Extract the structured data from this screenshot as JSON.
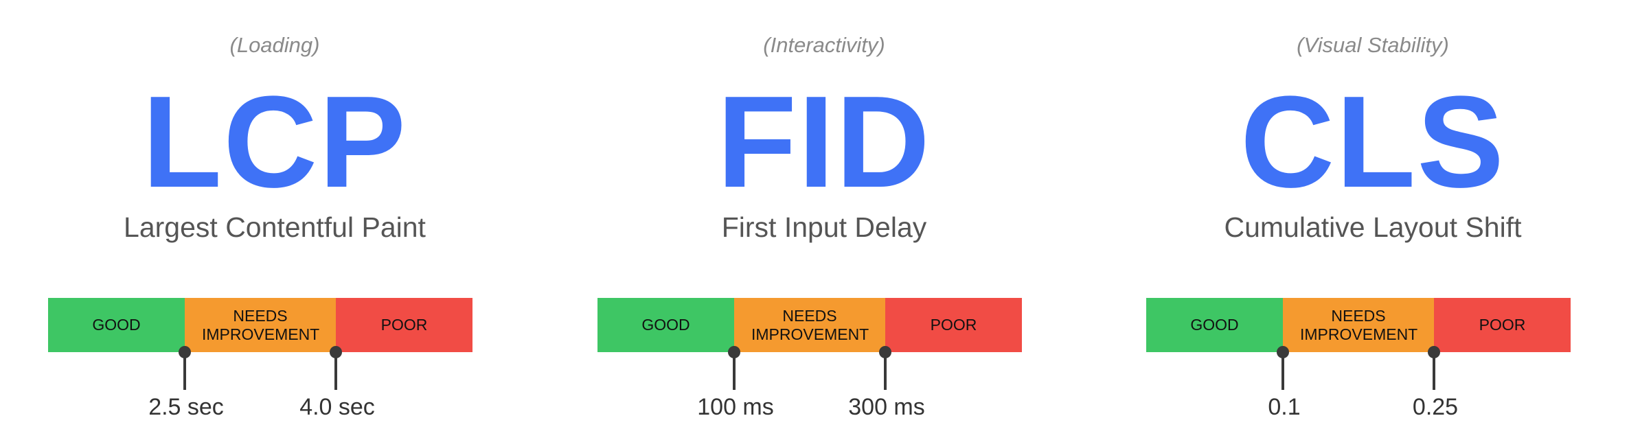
{
  "metrics": [
    {
      "category": "(Loading)",
      "abbr": "LCP",
      "name": "Largest Contentful Paint",
      "segments": {
        "good": "GOOD",
        "needs": "NEEDS IMPROVEMENT",
        "poor": "POOR"
      },
      "thresholds": [
        "2.5 sec",
        "4.0 sec"
      ]
    },
    {
      "category": "(Interactivity)",
      "abbr": "FID",
      "name": "First Input Delay",
      "segments": {
        "good": "GOOD",
        "needs": "NEEDS IMPROVEMENT",
        "poor": "POOR"
      },
      "thresholds": [
        "100 ms",
        "300 ms"
      ]
    },
    {
      "category": "(Visual Stability)",
      "abbr": "CLS",
      "name": "Cumulative Layout Shift",
      "segments": {
        "good": "GOOD",
        "needs": "NEEDS IMPROVEMENT",
        "poor": "POOR"
      },
      "thresholds": [
        "0.1",
        "0.25"
      ]
    }
  ],
  "colors": {
    "accent": "#3f72f6",
    "good": "#3ec664",
    "needs": "#f59a2f",
    "poor": "#f14c45"
  }
}
